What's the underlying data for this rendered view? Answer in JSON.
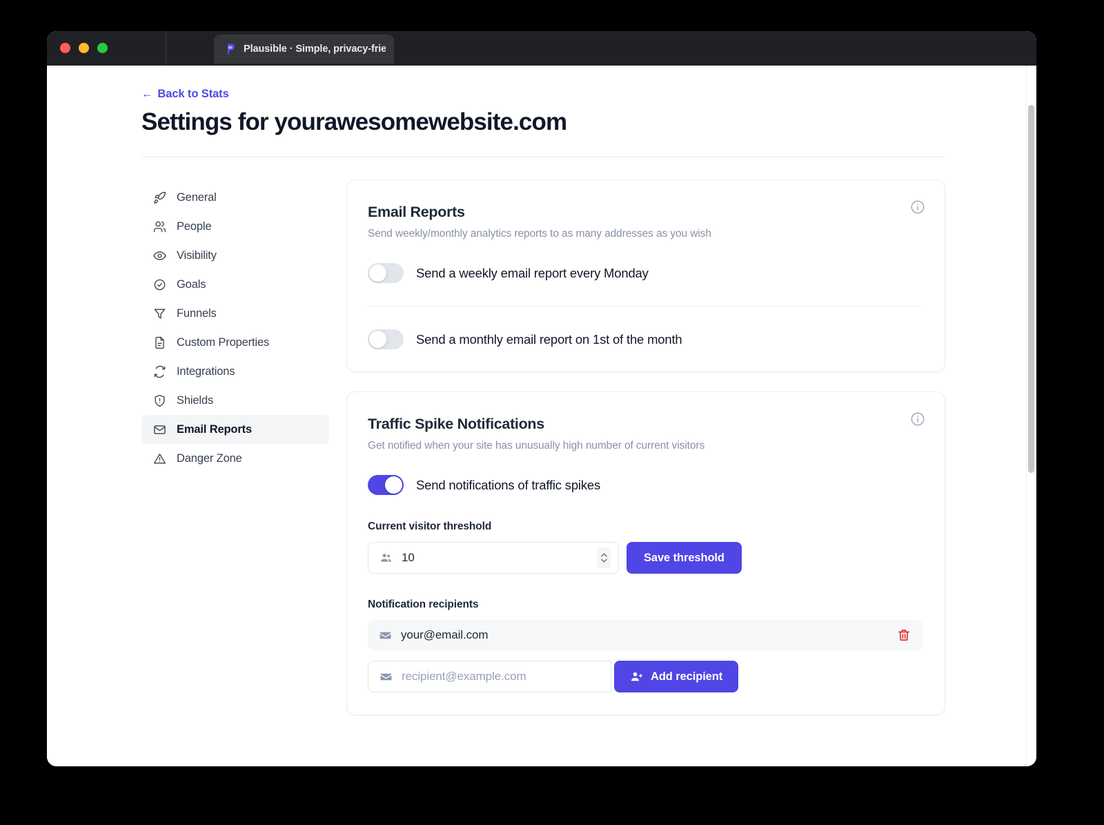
{
  "browser": {
    "tab_title": "Plausible · Simple, privacy-frien",
    "favicon_name": "plausible-logo",
    "traffic_lights": [
      "close",
      "minimize",
      "zoom"
    ]
  },
  "header": {
    "back_link": "← Back to Stats",
    "back_arrow": "←",
    "back_label": "Back to Stats",
    "page_title": "Settings for yourawesomewebsite.com"
  },
  "sidebar": {
    "items": [
      {
        "label": "General",
        "icon": "rocket-icon",
        "active": false
      },
      {
        "label": "People",
        "icon": "people-icon",
        "active": false
      },
      {
        "label": "Visibility",
        "icon": "eye-icon",
        "active": false
      },
      {
        "label": "Goals",
        "icon": "check-circle-icon",
        "active": false
      },
      {
        "label": "Funnels",
        "icon": "funnel-icon",
        "active": false
      },
      {
        "label": "Custom Properties",
        "icon": "document-icon",
        "active": false
      },
      {
        "label": "Integrations",
        "icon": "refresh-icon",
        "active": false
      },
      {
        "label": "Shields",
        "icon": "shield-icon",
        "active": false
      },
      {
        "label": "Email Reports",
        "icon": "envelope-icon",
        "active": true
      },
      {
        "label": "Danger Zone",
        "icon": "warning-icon",
        "active": false
      }
    ]
  },
  "email_reports_card": {
    "title": "Email Reports",
    "subtitle": "Send weekly/monthly analytics reports to as many addresses as you wish",
    "info_icon": "info-icon",
    "toggles": [
      {
        "label": "Send a weekly email report every Monday",
        "on": false
      },
      {
        "label": "Send a monthly email report on 1st of the month",
        "on": false
      }
    ]
  },
  "traffic_spike_card": {
    "title": "Traffic Spike Notifications",
    "subtitle": "Get notified when your site has unusually high number of current visitors",
    "info_icon": "info-icon",
    "toggle": {
      "label": "Send notifications of traffic spikes",
      "on": true
    },
    "threshold": {
      "label": "Current visitor threshold",
      "value": "10",
      "icon": "people-icon",
      "stepper_icon": "stepper-updown-icon",
      "save_button": "Save threshold"
    },
    "recipients": {
      "label": "Notification recipients",
      "list": [
        {
          "email": "your@email.com",
          "icon": "envelope-icon",
          "delete_icon": "trash-icon"
        }
      ],
      "new_placeholder": "recipient@example.com",
      "new_value": "",
      "new_icon": "envelope-icon",
      "add_button": "Add recipient",
      "add_button_icon": "user-plus-icon"
    }
  },
  "colors": {
    "accent": "#4f46e5",
    "danger": "#e02424",
    "title": "#101828",
    "muted": "#8892a4",
    "card_border": "#eceef1",
    "active_nav_bg": "#f4f5f7",
    "toggle_off": "#e2e5ea"
  },
  "scrollbar": {
    "name": "vertical-scrollbar"
  }
}
